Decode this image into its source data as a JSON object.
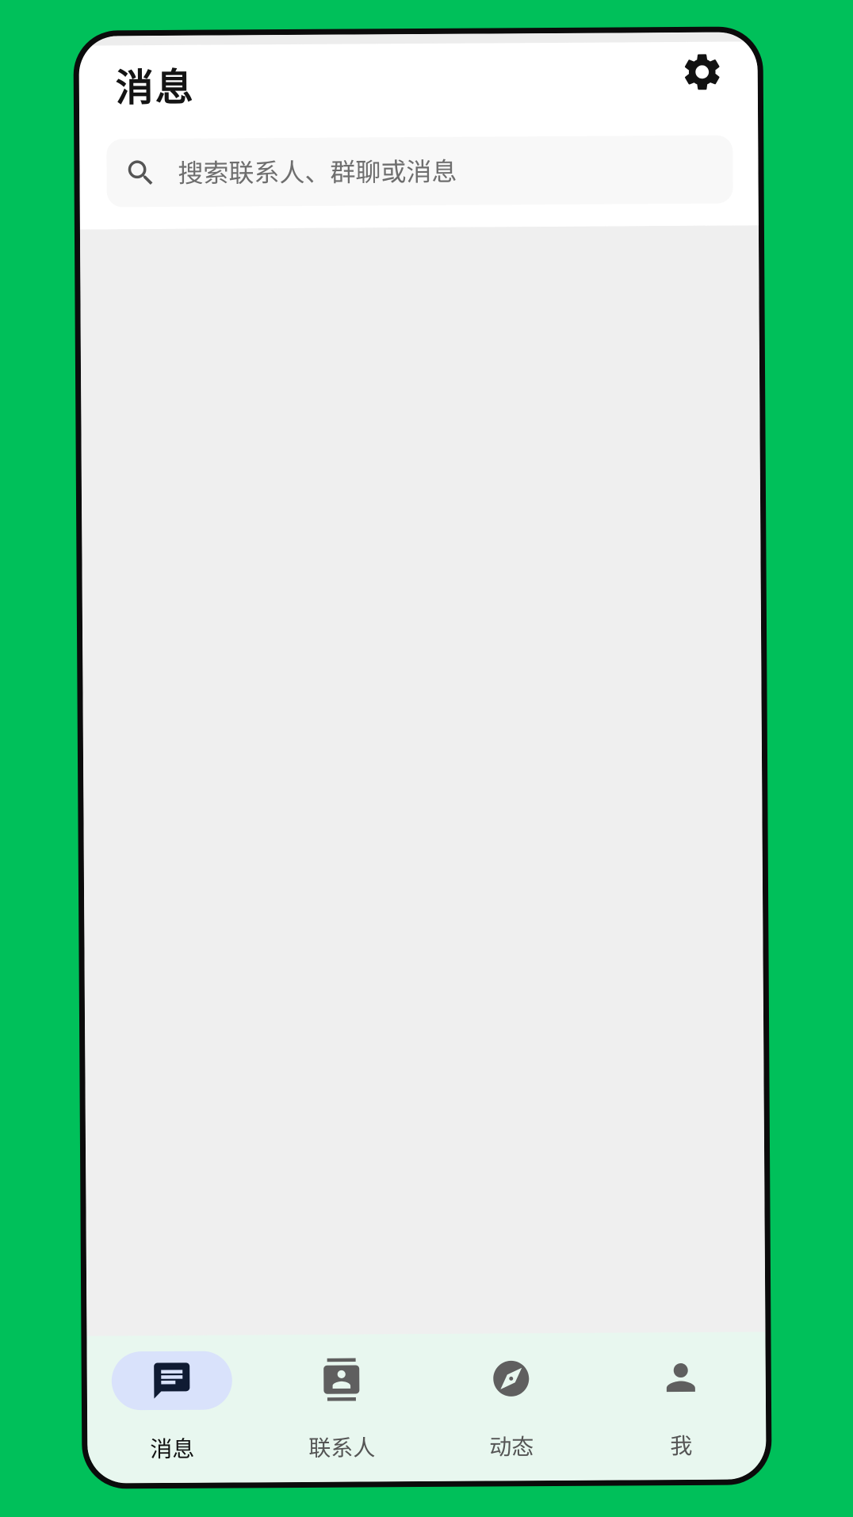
{
  "header": {
    "title": "消息",
    "settings_icon": "gear-icon"
  },
  "search": {
    "placeholder": "搜索联系人、群聊或消息",
    "value": "",
    "icon": "search-icon"
  },
  "bottom_nav": {
    "active_index": 0,
    "items": [
      {
        "label": "消息",
        "icon": "chat-icon"
      },
      {
        "label": "联系人",
        "icon": "contacts-icon"
      },
      {
        "label": "动态",
        "icon": "compass-icon"
      },
      {
        "label": "我",
        "icon": "person-icon"
      }
    ]
  },
  "colors": {
    "background": "#00C05A",
    "frame": "#0B0B0B",
    "header": "#FFFFFF",
    "content": "#EFEFEF",
    "nav_background": "#E8F7EF",
    "active_pill": "#D9E2FB",
    "active_icon": "#0F1B33",
    "inactive_icon": "#5F5F5F"
  }
}
